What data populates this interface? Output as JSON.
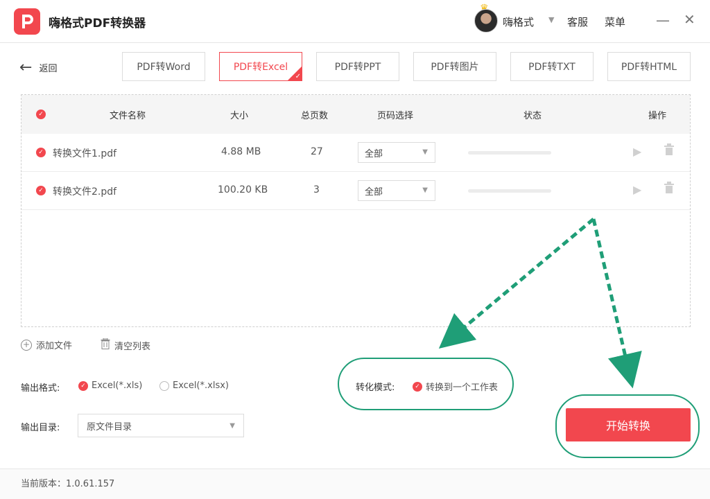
{
  "app": {
    "title": "嗨格式PDF转换器"
  },
  "header": {
    "username": "嗨格式",
    "service_label": "客服",
    "menu_label": "菜单",
    "minimize": "—",
    "close": "✕"
  },
  "nav": {
    "back_label": "返回",
    "tabs": [
      {
        "label": "PDF转Word"
      },
      {
        "label": "PDF转Excel"
      },
      {
        "label": "PDF转PPT"
      },
      {
        "label": "PDF转图片"
      },
      {
        "label": "PDF转TXT"
      },
      {
        "label": "PDF转HTML"
      }
    ],
    "active_tab": "PDF转Excel"
  },
  "table": {
    "columns": {
      "name": "文件名称",
      "size": "大小",
      "pages": "总页数",
      "page_select": "页码选择",
      "status": "状态",
      "actions": "操作"
    },
    "rows": [
      {
        "name": "转换文件1.pdf",
        "size": "4.88 MB",
        "pages": "27",
        "page_select": "全部",
        "progress": 0
      },
      {
        "name": "转换文件2.pdf",
        "size": "100.20 KB",
        "pages": "3",
        "page_select": "全部",
        "progress": 0
      }
    ]
  },
  "tools": {
    "add_file": "添加文件",
    "clear_list": "清空列表"
  },
  "output": {
    "format_label": "输出格式:",
    "format_options": [
      {
        "label": "Excel(*.xls)",
        "selected": true
      },
      {
        "label": "Excel(*.xlsx)",
        "selected": false
      }
    ],
    "dir_label": "输出目录:",
    "dir_value": "原文件目录"
  },
  "mode": {
    "label": "转化模式:",
    "option": "转换到一个工作表",
    "selected": true
  },
  "actions": {
    "start_label": "开始转换"
  },
  "footer": {
    "version": "当前版本：1.0.61.157"
  },
  "colors": {
    "accent": "#f2474e",
    "annotation": "#1f9e77"
  }
}
